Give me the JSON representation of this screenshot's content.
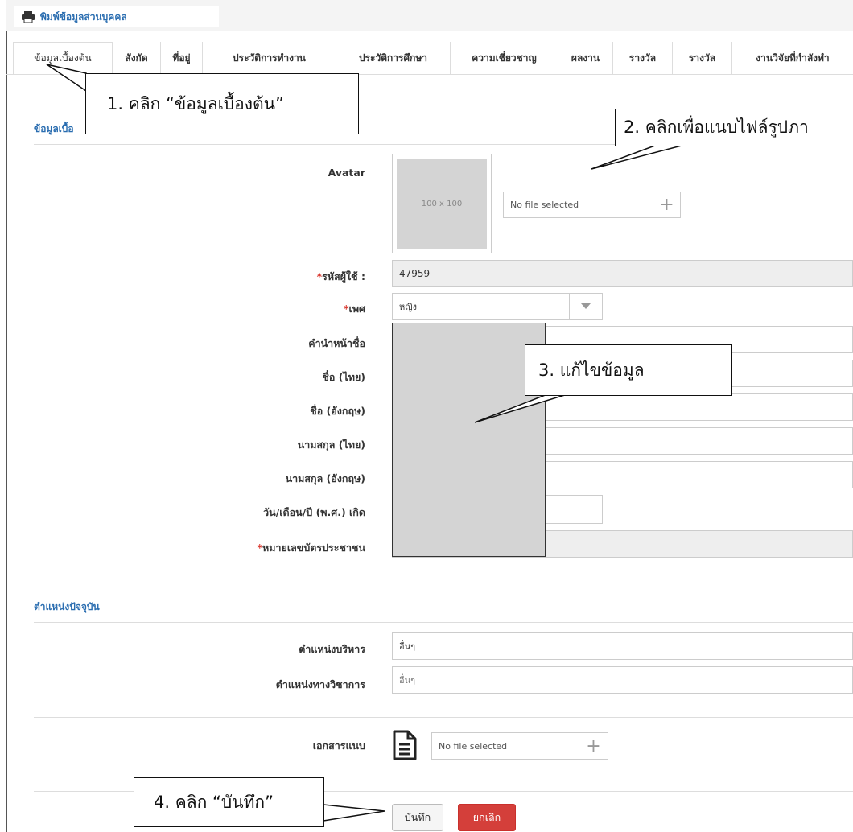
{
  "header": {
    "print_label": "พิมพ์ข้อมูลส่วนบุคคล"
  },
  "tabs": [
    "ข้อมูลเบื้องต้น",
    "สังกัด",
    "ที่อยู่",
    "ประวัติการทำงาน",
    "ประวัติการศึกษา",
    "ความเชี่ยวชาญ",
    "ผลงาน",
    "รางวัล",
    "รางวัล",
    "งานวิจัยที่กำลังทำ"
  ],
  "section_basic": {
    "title": "ข้อมูลเบื้อ"
  },
  "avatar": {
    "label": "Avatar",
    "placeholder": "100 x 100",
    "file_text": "No file selected"
  },
  "fields": {
    "user_id_label": "รหัสผู้ใช้ :",
    "user_id_value": "47959",
    "gender_label": "เพศ",
    "gender_value": "หญิง",
    "prefix_label": "คำนำหน้าชื่อ",
    "first_th_label": "ชื่อ (ไทย)",
    "first_en_label": "ชื่อ (อังกฤษ)",
    "last_th_label": "นามสกุล (ไทย)",
    "last_en_label": "นามสกุล (อังกฤษ)",
    "dob_label": "วัน/เดือน/ปี (พ.ศ.) เกิด",
    "citizen_id_label": "หมายเลขบัตรประชาชน",
    "required_mark": "*"
  },
  "section_position": {
    "title": "ตำแหน่งปัจจุบัน",
    "admin_label": "ตำแหน่งบริหาร",
    "admin_value": "อื่นๆ",
    "academic_label": "ตำแหน่งทางวิชาการ",
    "academic_value": "อื่นๆ"
  },
  "attachment": {
    "label": "เอกสารแนบ",
    "file_text": "No file selected"
  },
  "buttons": {
    "save": "บันทึก",
    "cancel": "ยกเลิก"
  },
  "callouts": {
    "step1": "1. คลิก “ข้อมูลเบื้องต้น”",
    "step2": "2. คลิกเพื่อแนบไฟล์รูปภา",
    "step3": "3. แก้ไขข้อมูล",
    "step4": "4. คลิก “บันทึก”"
  }
}
